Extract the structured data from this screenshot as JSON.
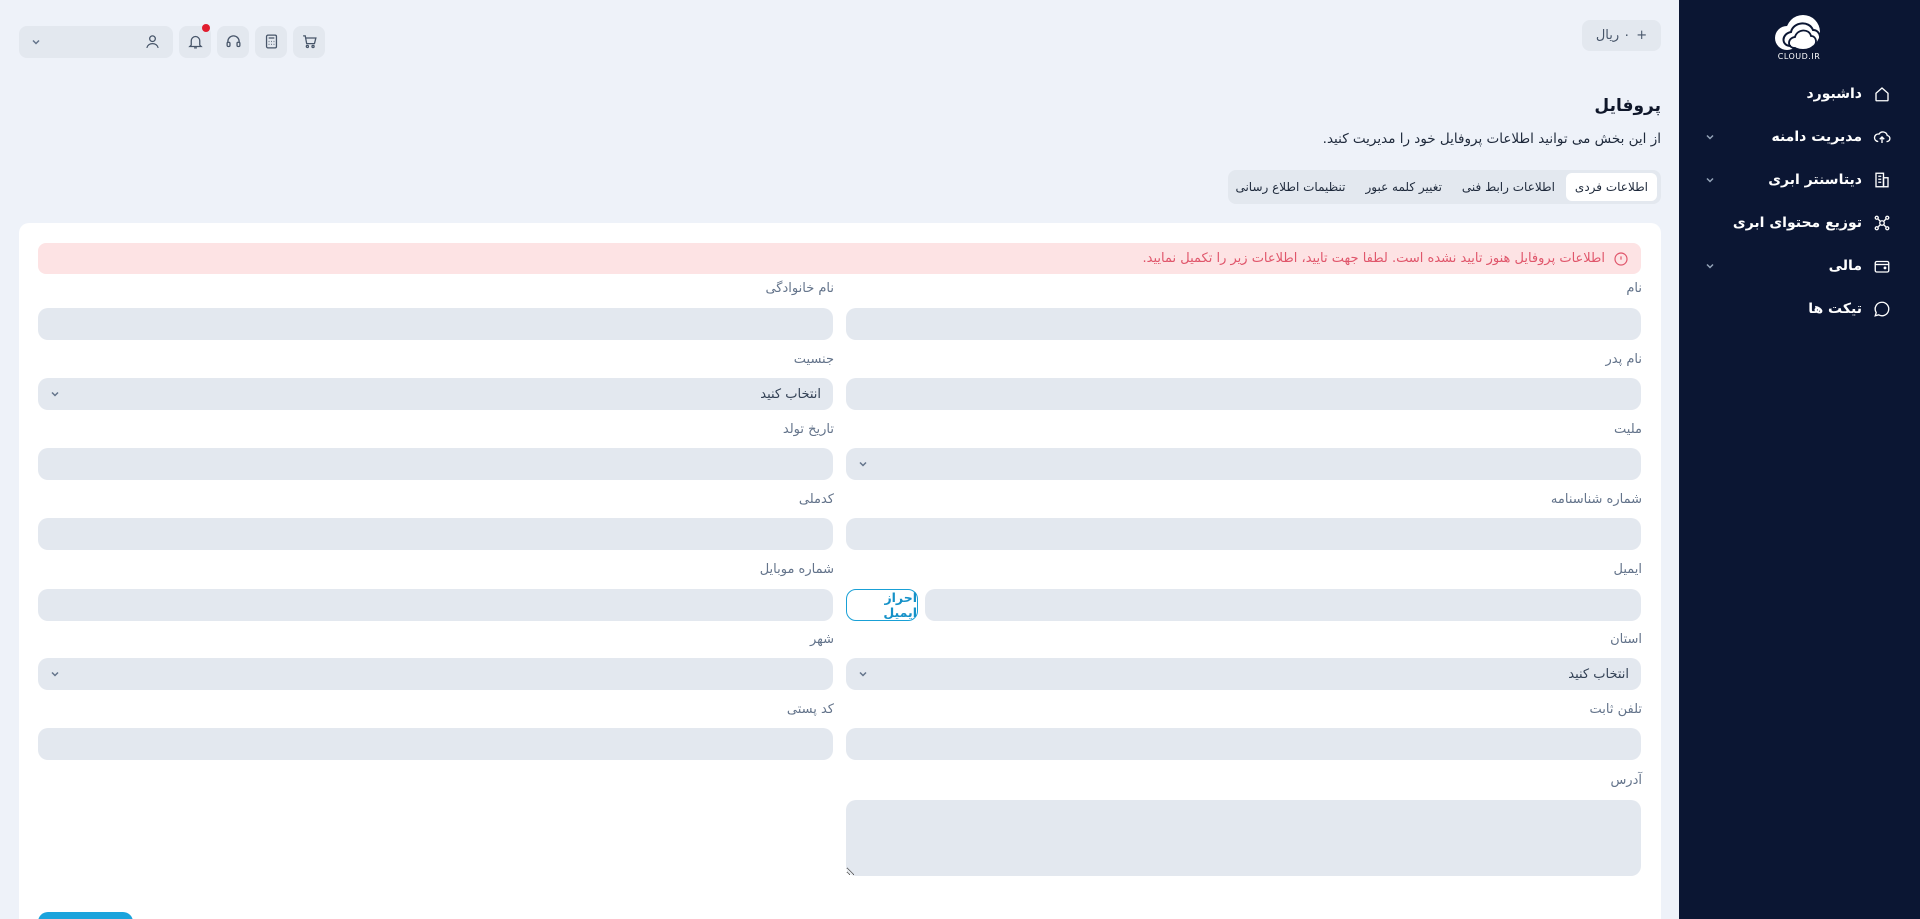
{
  "brand": {
    "logo_text": "CLOUD.IR"
  },
  "sidebar": {
    "items": [
      {
        "label": "داشبورد",
        "icon": "home-icon",
        "has_children": false
      },
      {
        "label": "مدیریت دامنه",
        "icon": "cloud-upload-icon",
        "has_children": true
      },
      {
        "label": "دیتاسنتر ابری",
        "icon": "building-icon",
        "has_children": true
      },
      {
        "label": "توزیع محتوای ابری",
        "icon": "network-icon",
        "has_children": false
      },
      {
        "label": "مالی",
        "icon": "wallet-icon",
        "has_children": true
      },
      {
        "label": "تیکت ها",
        "icon": "chat-icon",
        "has_children": false
      }
    ]
  },
  "topbar": {
    "credit_label": "۰ ریال",
    "icons": [
      "cart-icon",
      "calculator-icon",
      "headset-icon",
      "bell-icon",
      "user-icon"
    ]
  },
  "header": {
    "title": "پروفایل",
    "subtitle": "از این بخش می توانید اطلاعات پروفایل خود را مدیریت کنید."
  },
  "tabs": [
    {
      "label": "اطلاعات فردی",
      "active": true
    },
    {
      "label": "اطلاعات رابط فنی",
      "active": false
    },
    {
      "label": "تغییر کلمه عبور",
      "active": false
    },
    {
      "label": "تنظیمات اطلاع رسانی",
      "active": false
    }
  ],
  "alert": {
    "text": "اطلاعات پروفایل هنوز تایید نشده است. لطفا جهت تایید، اطلاعات زیر را تکمیل نمایید."
  },
  "form": {
    "first_name": {
      "label": "نام",
      "value": ""
    },
    "last_name": {
      "label": "نام خانوادگی",
      "value": ""
    },
    "father_name": {
      "label": "نام پدر",
      "value": ""
    },
    "gender": {
      "label": "جنسیت",
      "value": "انتخاب کنید"
    },
    "nationality": {
      "label": "ملیت",
      "value": ""
    },
    "birth_date": {
      "label": "تاریخ تولد",
      "value": ""
    },
    "id_number": {
      "label": "شماره شناسنامه",
      "value": ""
    },
    "national_code": {
      "label": "کدملی",
      "value": ""
    },
    "email": {
      "label": "ایمیل",
      "value": "",
      "verify_label": "احراز ایمیل"
    },
    "mobile": {
      "label": "شماره موبایل",
      "value": ""
    },
    "province": {
      "label": "استان",
      "value": "انتخاب کنید"
    },
    "city": {
      "label": "شهر",
      "value": ""
    },
    "landline": {
      "label": "تلفن ثابت",
      "value": ""
    },
    "postal_code": {
      "label": "کد پستی",
      "value": ""
    },
    "address": {
      "label": "آدرس",
      "value": ""
    }
  },
  "colors": {
    "sidebar_bg": "#0b1633",
    "page_bg": "#eef2f9",
    "accent": "#1aa3dc",
    "alert_bg": "#fde3e4",
    "alert_text": "#e0566b",
    "notification_dot": "#e11d2e"
  }
}
